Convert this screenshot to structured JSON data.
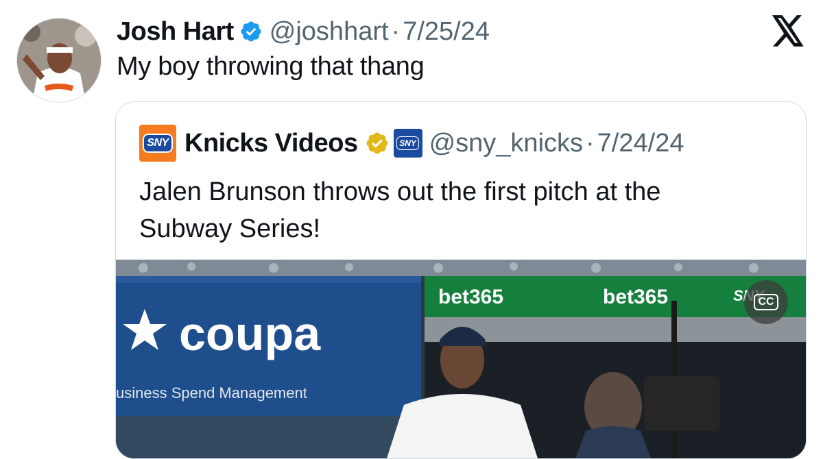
{
  "tweet": {
    "author_name": "Josh Hart",
    "handle": "@joshhart",
    "separator": "·",
    "date": "7/25/24",
    "text": "My boy throwing that thang"
  },
  "quoted_tweet": {
    "author_name": "Knicks Videos",
    "logo_text": "SNY",
    "handle": "@sny_knicks",
    "separator": "·",
    "date": "7/24/24",
    "text_line1": "Jalen Brunson throws out the first pitch at the",
    "text_line2": "Subway Series!",
    "media": {
      "sign_brand": "coupa",
      "sign_tagline": "usiness Spend Management",
      "ad_board_1": "bet365",
      "ad_board_2": "bet365",
      "ad_board_3": "SNY",
      "captions_button": "CC"
    }
  },
  "colors": {
    "verified_blue": "#1d9bf0",
    "gold_badge": "#e2b719",
    "muted_text": "#536471",
    "sny_orange": "#f47b20",
    "sny_blue": "#1a4ba0",
    "bet365_green": "#15803d",
    "bet365_yellow": "#ffdf1b",
    "coupa_blue": "#1f4e8c"
  },
  "icons": [
    "avatar",
    "verified-badge-icon",
    "x-logo-icon",
    "sny-logo",
    "gold-verified-badge-icon",
    "sny-affiliate-icon",
    "closed-captions-icon"
  ]
}
